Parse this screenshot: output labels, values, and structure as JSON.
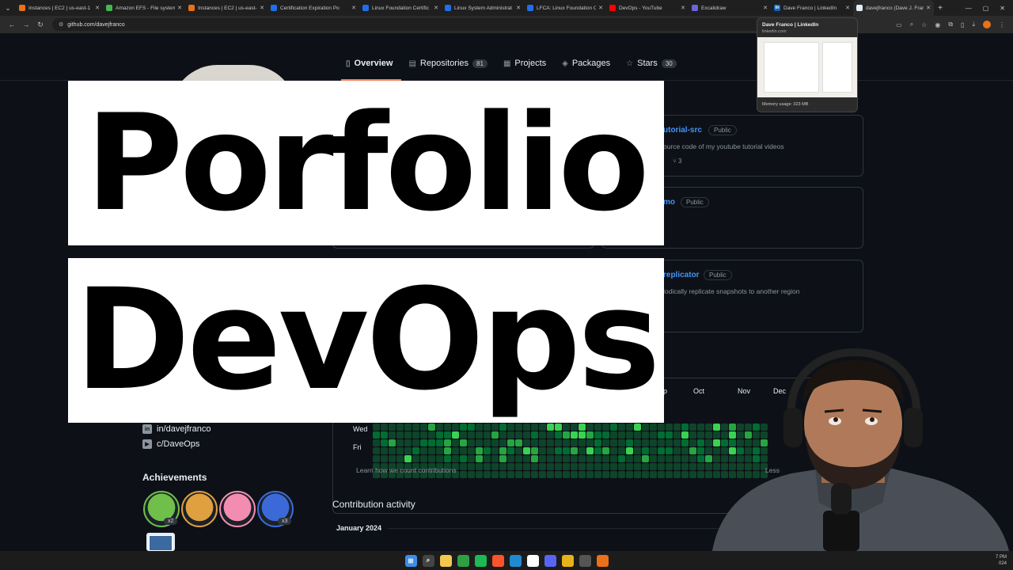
{
  "browser": {
    "tabs": [
      {
        "title": "Instances | EC2 | us-east-1",
        "color": "#e8711a",
        "glyph": ""
      },
      {
        "title": "Amazon EFS - File system",
        "color": "#3fb950",
        "glyph": ""
      },
      {
        "title": "Instances | EC2 | us-east-1",
        "color": "#e8711a",
        "glyph": ""
      },
      {
        "title": "Certification Expiration Po",
        "color": "#1f6feb",
        "glyph": ""
      },
      {
        "title": "Linux Foundation Certific",
        "color": "#1f6feb",
        "glyph": ""
      },
      {
        "title": "Linux System Administrat",
        "color": "#1f6feb",
        "glyph": ""
      },
      {
        "title": "LFCA: Linux Foundation C",
        "color": "#1f6feb",
        "glyph": ""
      },
      {
        "title": "DevOps - YouTube",
        "color": "#ff0000",
        "glyph": ""
      },
      {
        "title": "Excalidraw",
        "color": "#6965db",
        "glyph": ""
      },
      {
        "title": "Dave Franco | LinkedIn",
        "color": "#0a66c2",
        "glyph": "in"
      },
      {
        "title": "davejfranco (Dave J. Franc",
        "color": "#e6edf3",
        "glyph": ""
      }
    ],
    "url": "github.com/davejfranco",
    "preview": {
      "title": "Dave Franco | LinkedIn",
      "url": "linkedin.com",
      "memory": "Memory usage: 323 MB"
    }
  },
  "github": {
    "tabs": [
      {
        "label": "Overview",
        "icon": "book-icon",
        "glyph": "▯",
        "count": ""
      },
      {
        "label": "Repositories",
        "icon": "repo-icon",
        "glyph": "▤",
        "count": "81"
      },
      {
        "label": "Projects",
        "icon": "project-icon",
        "glyph": "▦",
        "count": ""
      },
      {
        "label": "Packages",
        "icon": "package-icon",
        "glyph": "◈",
        "count": ""
      },
      {
        "label": "Stars",
        "icon": "star-icon",
        "glyph": "☆",
        "count": "30"
      }
    ],
    "repos": [
      {
        "name": "utorial-src",
        "visibility": "Public",
        "description": "ource code of my youtube tutorial videos",
        "forks": "3"
      },
      {
        "name": "mo",
        "visibility": "Public",
        "description": "",
        "forks": ""
      },
      {
        "name": "replicator",
        "visibility": "Public",
        "description": "iodically replicate snapshots to another region",
        "forks": ""
      }
    ],
    "contributions": {
      "months": [
        "p",
        "Oct",
        "Nov",
        "Dec"
      ],
      "days": [
        "Wed",
        "Fri"
      ],
      "learn_link": "Learn how we count contributions",
      "legend_less": "Less",
      "colors": {
        "empty": "#161b22",
        "l1": "#0e4429",
        "l2": "#006d32",
        "l3": "#26a641",
        "l4": "#39d353"
      }
    },
    "social": [
      {
        "label": "in/davejfranco",
        "icon": "linkedin-icon",
        "glyph": "in"
      },
      {
        "label": "c/DaveOps",
        "icon": "youtube-icon",
        "glyph": "▶"
      }
    ],
    "achievements": {
      "title": "Achievements",
      "badges": [
        {
          "name": "pair-extraordinaire",
          "color": "#6fbf4a",
          "multiplier": "x2"
        },
        {
          "name": "starstruck",
          "color": "#e0a040",
          "multiplier": ""
        },
        {
          "name": "yolo",
          "color": "#f28cb1",
          "multiplier": ""
        },
        {
          "name": "pull-shark",
          "color": "#3b6ad8",
          "multiplier": "x3"
        }
      ]
    },
    "activity": {
      "title": "Contribution activity",
      "month": "January 2024"
    }
  },
  "overlay": {
    "line1": "Porfolio",
    "line2": "DevOps"
  },
  "taskbar": {
    "apps": [
      {
        "name": "start-icon",
        "color": "#3b8eea",
        "glyph": "⊞"
      },
      {
        "name": "search-icon",
        "color": "#444",
        "glyph": "⌕"
      },
      {
        "name": "file-explorer-icon",
        "color": "#f2c94c",
        "glyph": ""
      },
      {
        "name": "xbox-icon",
        "color": "#2ea043",
        "glyph": ""
      },
      {
        "name": "spotify-icon",
        "color": "#1db954",
        "glyph": ""
      },
      {
        "name": "brave-icon",
        "color": "#fb542b",
        "glyph": ""
      },
      {
        "name": "vscode-icon",
        "color": "#1f8ad2",
        "glyph": ""
      },
      {
        "name": "notion-icon",
        "color": "#ffffff",
        "glyph": ""
      },
      {
        "name": "discord-icon",
        "color": "#5865f2",
        "glyph": ""
      },
      {
        "name": "chrome-icon",
        "color": "#e8b21a",
        "glyph": ""
      },
      {
        "name": "obs-icon",
        "color": "#555",
        "glyph": ""
      },
      {
        "name": "chrome-dev-icon",
        "color": "#e8711a",
        "glyph": ""
      }
    ],
    "clock": "7 PM",
    "date": "024"
  }
}
